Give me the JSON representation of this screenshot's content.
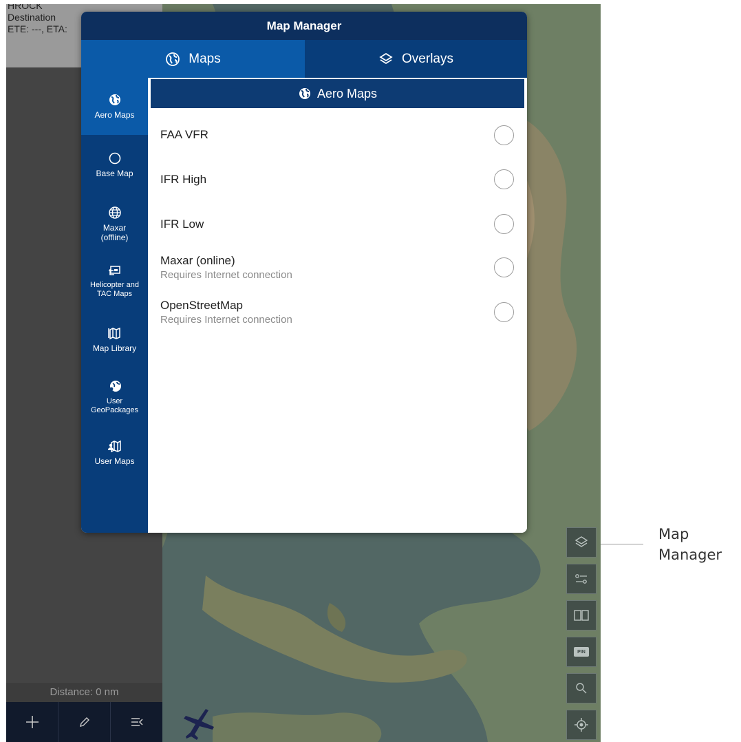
{
  "colors": {
    "modal_title_bg": "#0d2f5e",
    "maps_tab_bg": "#0b5aa8",
    "overlays_tab_bg": "#083d7a",
    "sidebar_bg": "#083d7a",
    "sidebar_active_bg": "#0b5aa8",
    "content_header_bg": "#0d3b73",
    "left_panel_bg": "#444444",
    "route_info_bg": "#9a9a9a"
  },
  "route_info": {
    "line1": "HROCK",
    "line2": "Destination",
    "line3": "ETE: ---, ETA:"
  },
  "modal": {
    "title": "Map Manager",
    "tabs": [
      {
        "label": "Maps",
        "icon": "globe-icon",
        "selected": true
      },
      {
        "label": "Overlays",
        "icon": "layers-icon",
        "selected": false
      }
    ],
    "sidebar": {
      "items": [
        {
          "label": "Aero Maps",
          "icon": "globe-americas-icon",
          "selected": true
        },
        {
          "label": "Base Map",
          "icon": "circle-icon",
          "selected": false
        },
        {
          "label": "Maxar\n(offline)",
          "icon": "globe-grid-icon",
          "selected": false
        },
        {
          "label": "Helicopter and\nTAC Maps",
          "icon": "helicopter-map-icon",
          "selected": false
        },
        {
          "label": "Map Library",
          "icon": "map-library-icon",
          "selected": false
        },
        {
          "label": "User\nGeoPackages",
          "icon": "user-globe-icon",
          "selected": false
        },
        {
          "label": "User Maps",
          "icon": "user-map-icon",
          "selected": false
        }
      ]
    },
    "content": {
      "header": "Aero Maps",
      "options": [
        {
          "label": "FAA VFR",
          "sublabel": "",
          "selected": false
        },
        {
          "label": "IFR High",
          "sublabel": "",
          "selected": false
        },
        {
          "label": "IFR Low",
          "sublabel": "",
          "selected": false
        },
        {
          "label": "Maxar (online)",
          "sublabel": "Requires Internet connection",
          "selected": false
        },
        {
          "label": "OpenStreetMap",
          "sublabel": "Requires Internet connection",
          "selected": false
        }
      ]
    }
  },
  "status": {
    "distance": "Distance: 0 nm"
  },
  "bottom_toolbar": [
    "plus-icon",
    "pencil-icon",
    "route-list-icon"
  ],
  "right_toolbar": [
    "layers-icon",
    "settings-sliders-icon",
    "split-view-icon",
    "pin-icon",
    "search-icon",
    "locate-icon"
  ],
  "pin_button_text": "PIN",
  "callout": {
    "line1": "Map",
    "line2": "Manager"
  }
}
